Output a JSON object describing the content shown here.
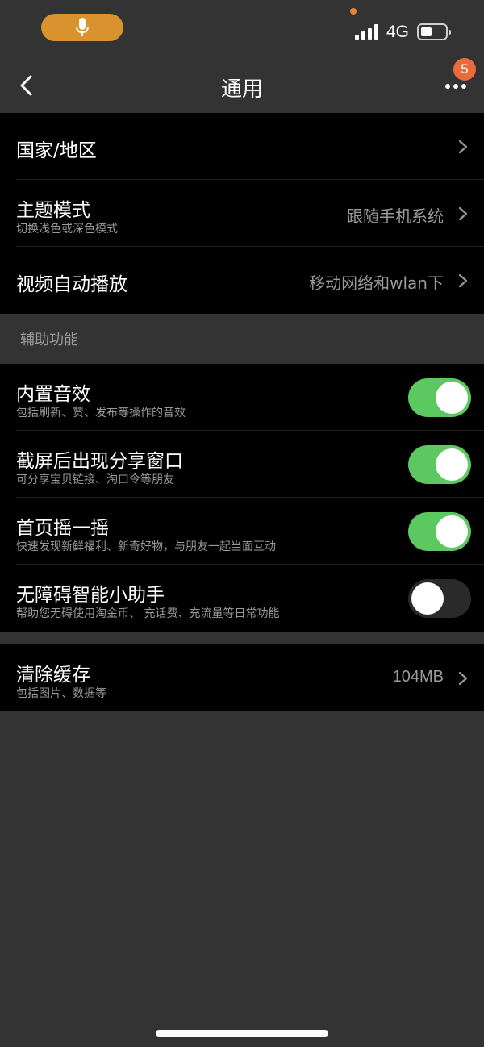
{
  "status_bar": {
    "network": "4G",
    "signal_bars": 4,
    "battery_level_percent": 45,
    "accent_color": "#d8922e"
  },
  "header": {
    "title": "通用",
    "notification_count": "5"
  },
  "group_general": [
    {
      "title": "国家/地区",
      "subtitle": "",
      "value": ""
    },
    {
      "title": "主题模式",
      "subtitle": "切换浅色或深色模式",
      "value": "跟随手机系统"
    },
    {
      "title": "视频自动播放",
      "subtitle": "",
      "value": "移动网络和wlan下"
    }
  ],
  "section_accessibility": {
    "label": "辅助功能",
    "items": [
      {
        "title": "内置音效",
        "subtitle": "包括刷新、赞、发布等操作的音效",
        "enabled": true
      },
      {
        "title": "截屏后出现分享窗口",
        "subtitle": "可分享宝贝链接、淘口令等朋友",
        "enabled": true
      },
      {
        "title": "首页摇一摇",
        "subtitle": "快速发现新鲜福利、新奇好物，与朋友一起当面互动",
        "enabled": true
      },
      {
        "title": "无障碍智能小助手",
        "subtitle": "帮助您无碍使用淘金币、 充话费、充流量等日常功能",
        "enabled": false
      }
    ]
  },
  "group_cache": {
    "title": "清除缓存",
    "subtitle": "包括图片、数据等",
    "value": "104MB"
  },
  "colors": {
    "toggle_on": "#5bc95f",
    "badge": "#ea6a3a",
    "background": "#333333",
    "row_background": "#000000"
  }
}
